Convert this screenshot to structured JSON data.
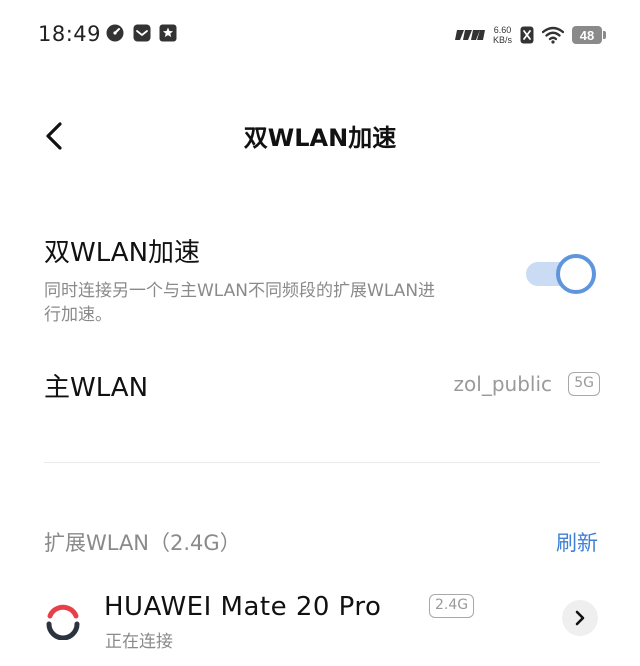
{
  "status_bar": {
    "time": "18:49",
    "left_icons": [
      "speedometer-icon",
      "message-icon",
      "star-note-icon"
    ],
    "network_speed_value": "6.60",
    "network_speed_unit": "KB/s",
    "battery_level": "48"
  },
  "header": {
    "title": "双WLAN加速",
    "back_icon": "chevron-left-icon"
  },
  "dual_wlan": {
    "title": "双WLAN加速",
    "description": "同时连接另一个与主WLAN不同频段的扩展WLAN进行加速。",
    "enabled": true
  },
  "primary_wlan": {
    "label": "主WLAN",
    "ssid": "zol_public",
    "band": "5G"
  },
  "extended_wlan": {
    "label": "扩展WLAN（2.4G）",
    "refresh_label": "刷新",
    "networks": [
      {
        "name": "HUAWEI Mate 20 Pro",
        "band": "2.4G",
        "status": "正在连接"
      }
    ]
  },
  "colors": {
    "accent": "#3f7fd4",
    "toggle_track": "#c9dcf3",
    "toggle_knob_border": "#5f95dd",
    "secondary_text": "#8a8a8a",
    "spinner_red": "#e8404a",
    "spinner_dark": "#2b3340"
  }
}
